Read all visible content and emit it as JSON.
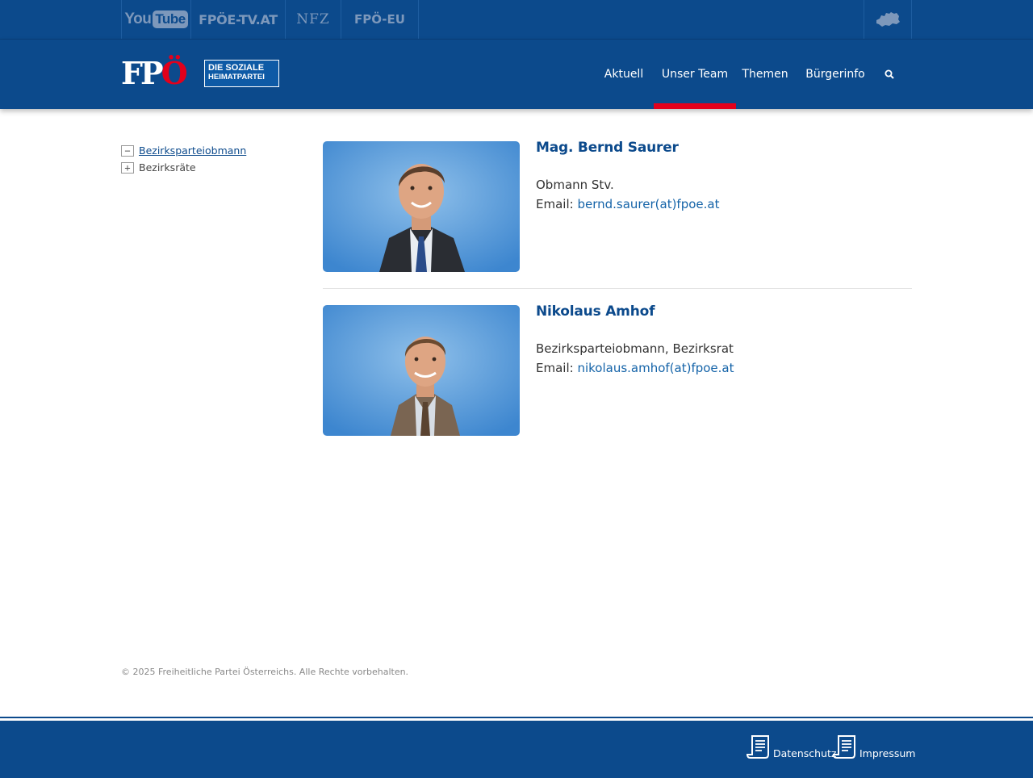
{
  "topbar": {
    "youtube": {
      "you": "You",
      "tube": "Tube"
    },
    "fpoe_tv": "FPÖE-TV.AT",
    "nfz": "NFZ",
    "fpoe_eu": "FPÖ-EU",
    "map_icon": "austria-map-icon"
  },
  "header": {
    "logo": {
      "letters": "FP",
      "letter_o": "Ö",
      "line1": "DIE SOZIALE",
      "line2": "HEIMATPARTEI"
    },
    "nav": [
      {
        "label": "Aktuell"
      },
      {
        "label": "Unser Team",
        "active": true
      },
      {
        "label": "Themen"
      },
      {
        "label": "Bürgerinfo"
      }
    ],
    "search_icon": "search-icon"
  },
  "sidebar": {
    "items": [
      {
        "label": "Bezirksparteiobmann",
        "toggle": "−",
        "active": true
      },
      {
        "label": "Bezirksräte",
        "toggle": "+",
        "active": false
      }
    ]
  },
  "people": [
    {
      "name": "Mag. Bernd Saurer",
      "role": "Obmann Stv.",
      "email_label": "Email:",
      "email": "bernd.saurer(at)fpoe.at"
    },
    {
      "name": "Nikolaus Amhof",
      "role": "Bezirksparteiobmann, Bezirksrat",
      "email_label": "Email:",
      "email": "nikolaus.amhof(at)fpoe.at"
    }
  ],
  "copyright": "© 2025 Freiheitliche Partei Österreichs. Alle Rechte vorbehalten.",
  "footer": {
    "links": [
      {
        "label": "Datenschutz",
        "icon": "document-icon"
      },
      {
        "label": "Impressum",
        "icon": "document-icon"
      }
    ]
  },
  "colors": {
    "brand_blue": "#0c4a8c",
    "accent_red": "#e3001b",
    "link_blue": "#1463a8"
  }
}
